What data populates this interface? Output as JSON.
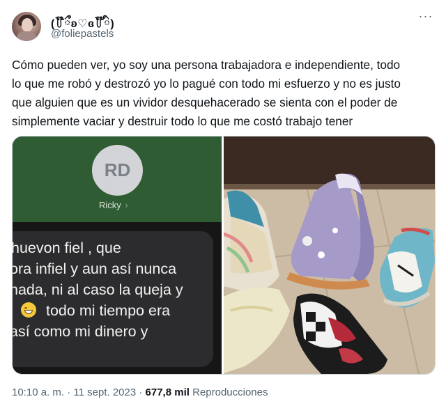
{
  "author": {
    "display_name": "(꒦໊ྀʚ♡ɞ꒦໊ི)",
    "handle": "@foliepastels"
  },
  "tweet": {
    "text": "Cómo pueden ver, yo soy una persona trabajadora e independiente, todo\nlo que me robó y destrozó yo lo pagué con todo mi esfuerzo y no es justo\nque alguien que es un vividor desquehacerado se sienta con el poder de\nsimplemente vaciar y destruir todo lo que me costó trabajo tener"
  },
  "media": {
    "screenshot": {
      "contact_initials": "RD",
      "contact_name": "Ricky",
      "message_lines": [
        "huevon fiel , que",
        "ora infiel y aun así nunca",
        "nada, ni al caso la queja y",
        "todo mi tiempo era",
        "así como mi dinero y"
      ],
      "emoji": "grinning-face-icon"
    },
    "photo_subject": "shoes-photo"
  },
  "footer": {
    "time": "10:10 a. m.",
    "separator1": " · ",
    "date": "11 sept. 2023",
    "separator2": " · ",
    "views_count": "677,8 mil",
    "views_label": " Reproducciones"
  },
  "icons": {
    "more": "more-options-icon"
  }
}
